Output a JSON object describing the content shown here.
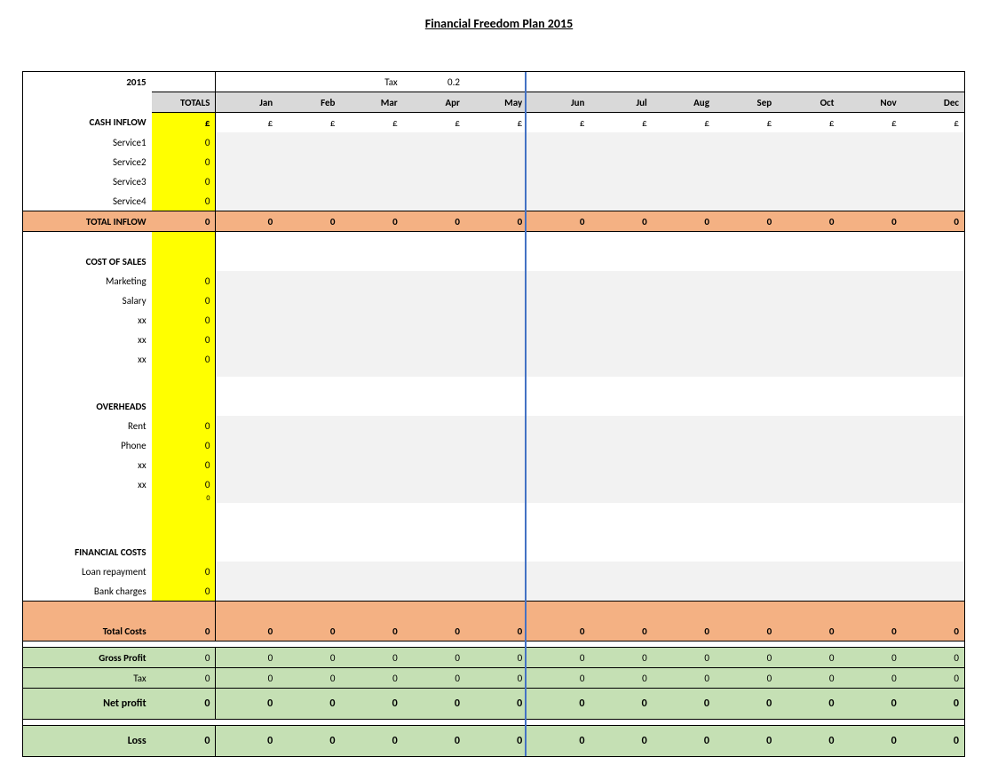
{
  "currency": "£",
  "pageTitle": "Financial Freedom Plan 2015",
  "header": {
    "year": "2015",
    "taxLabel": "Tax",
    "taxValue": "0.2",
    "totalsHdr": "TOTALS",
    "months": [
      "Jan",
      "Feb",
      "Mar",
      "Apr",
      "May",
      "Jun",
      "Jul",
      "Aug",
      "Sep",
      "Oct",
      "Nov",
      "Dec"
    ]
  },
  "inflow": {
    "title": "CASH INFLOW",
    "rows": [
      {
        "label": "Service1",
        "total": "0"
      },
      {
        "label": "Service2",
        "total": "0"
      },
      {
        "label": "Service3",
        "total": "0"
      },
      {
        "label": "Service4",
        "total": "0"
      }
    ]
  },
  "totalInflow": {
    "label": "TOTAL INFLOW",
    "total": "0",
    "months": [
      "0",
      "0",
      "0",
      "0",
      "0",
      "0",
      "0",
      "0",
      "0",
      "0",
      "0",
      "0"
    ]
  },
  "costSales": {
    "title": "COST OF SALES",
    "rows": [
      {
        "label": "Marketing",
        "total": "0"
      },
      {
        "label": "Salary",
        "total": "0"
      },
      {
        "label": "xx",
        "total": "0"
      },
      {
        "label": "xx",
        "total": "0"
      },
      {
        "label": "xx",
        "total": "0"
      }
    ]
  },
  "overheads": {
    "title": "OVERHEADS",
    "rows": [
      {
        "label": "Rent",
        "total": "0"
      },
      {
        "label": "Phone",
        "total": "0"
      },
      {
        "label": "xx",
        "total": "0"
      },
      {
        "label": "xx",
        "total": "0"
      }
    ],
    "tinyTotal": "0"
  },
  "financial": {
    "title": "FINANCIAL COSTS",
    "rows": [
      {
        "label": "Loan repayment",
        "total": "0"
      },
      {
        "label": "Bank charges",
        "total": "0"
      }
    ]
  },
  "totalCosts": {
    "label": "Total Costs",
    "total": "0",
    "months": [
      "0",
      "0",
      "0",
      "0",
      "0",
      "0",
      "0",
      "0",
      "0",
      "0",
      "0",
      "0"
    ]
  },
  "gross": {
    "label": "Gross Profit",
    "total": "0",
    "months": [
      "0",
      "0",
      "0",
      "0",
      "0",
      "0",
      "0",
      "0",
      "0",
      "0",
      "0",
      "0"
    ]
  },
  "taxRow": {
    "label": "Tax",
    "total": "0",
    "months": [
      "0",
      "0",
      "0",
      "0",
      "0",
      "0",
      "0",
      "0",
      "0",
      "0",
      "0",
      "0"
    ]
  },
  "net": {
    "label": "Net profit",
    "total": "0",
    "months": [
      "0",
      "0",
      "0",
      "0",
      "0",
      "0",
      "0",
      "0",
      "0",
      "0",
      "0",
      "0"
    ]
  },
  "loss": {
    "label": "Loss",
    "total": "0",
    "months": [
      "0",
      "0",
      "0",
      "0",
      "0",
      "0",
      "0",
      "0",
      "0",
      "0",
      "0",
      "0"
    ]
  }
}
